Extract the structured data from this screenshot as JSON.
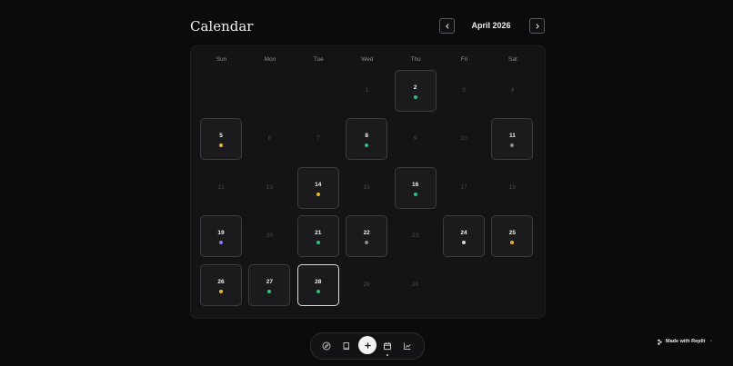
{
  "header": {
    "title": "Calendar",
    "month_label": "April 2026"
  },
  "weekdays": [
    "Sun",
    "Mon",
    "Tue",
    "Wed",
    "Thu",
    "Fri",
    "Sat"
  ],
  "colors": {
    "dot_green": "#2ec27e",
    "dot_yellow": "#e9b62c",
    "dot_gray": "#8a8a90",
    "dot_purple": "#8b7cf0",
    "dot_white": "#d8d8dc"
  },
  "calendar": {
    "days": [
      {
        "day": "1",
        "active": false
      },
      {
        "day": "2",
        "active": true,
        "dot": "green"
      },
      {
        "day": "3",
        "active": false
      },
      {
        "day": "4",
        "active": false
      },
      {
        "day": "5",
        "active": true,
        "dot": "yellow"
      },
      {
        "day": "6",
        "active": false
      },
      {
        "day": "7",
        "active": false
      },
      {
        "day": "8",
        "active": true,
        "dot": "green"
      },
      {
        "day": "9",
        "active": false
      },
      {
        "day": "10",
        "active": false
      },
      {
        "day": "11",
        "active": true,
        "dot": "gray"
      },
      {
        "day": "12",
        "active": false
      },
      {
        "day": "13",
        "active": false
      },
      {
        "day": "14",
        "active": true,
        "dot": "yellow"
      },
      {
        "day": "15",
        "active": false
      },
      {
        "day": "16",
        "active": true,
        "dot": "green"
      },
      {
        "day": "17",
        "active": false
      },
      {
        "day": "18",
        "active": false
      },
      {
        "day": "19",
        "active": true,
        "dot": "purple"
      },
      {
        "day": "20",
        "active": false
      },
      {
        "day": "21",
        "active": true,
        "dot": "green"
      },
      {
        "day": "22",
        "active": true,
        "dot": "gray"
      },
      {
        "day": "23",
        "active": false
      },
      {
        "day": "24",
        "active": true,
        "dot": "white"
      },
      {
        "day": "25",
        "active": true,
        "dot": "yellow"
      },
      {
        "day": "26",
        "active": true,
        "dot": "yellow"
      },
      {
        "day": "27",
        "active": true,
        "dot": "green"
      },
      {
        "day": "28",
        "active": true,
        "dot": "green",
        "today": true
      },
      {
        "day": "29",
        "active": false
      },
      {
        "day": "30",
        "active": false
      }
    ]
  },
  "dock": {
    "items": [
      "compass-icon",
      "book-icon",
      "plus-icon",
      "calendar-icon",
      "chart-icon"
    ],
    "selected": "calendar-icon"
  },
  "badge": {
    "label": "Made with Replit",
    "close": "×"
  }
}
